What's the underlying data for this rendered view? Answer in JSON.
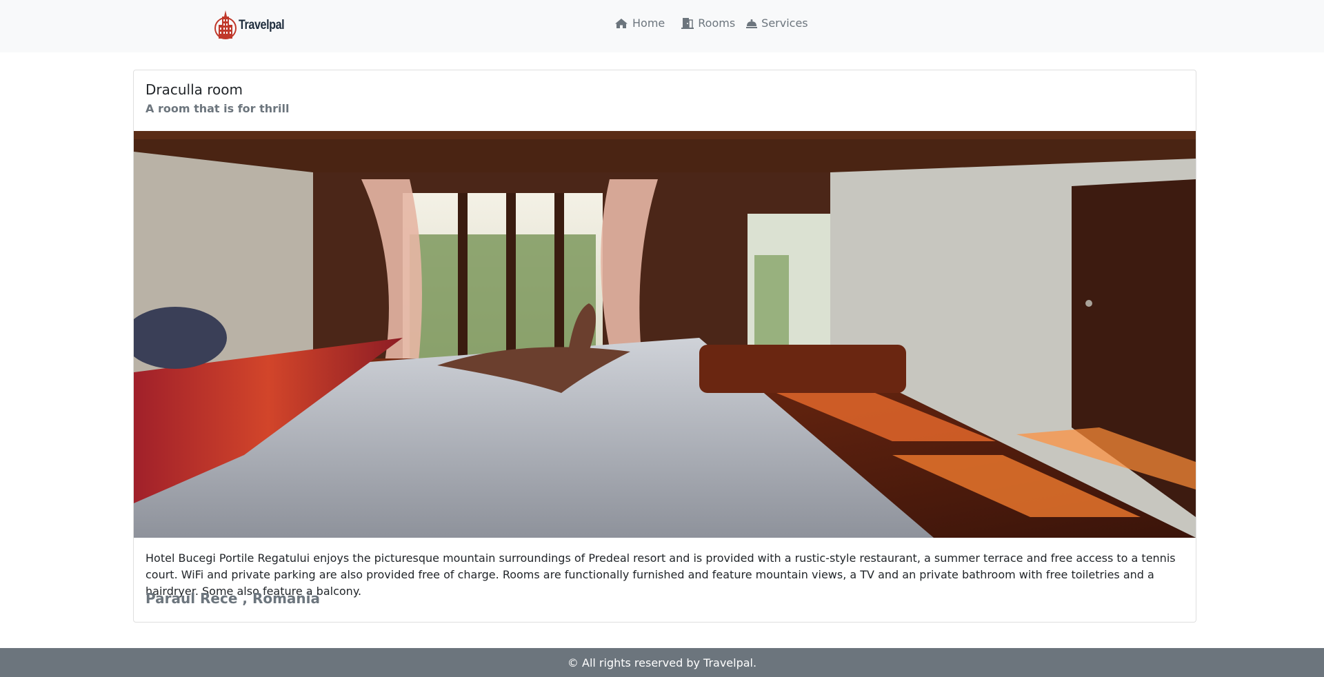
{
  "brand": {
    "name": "Travelpal",
    "logo_icon": "hotel-tower-icon",
    "accent": "#c0392b"
  },
  "nav": [
    {
      "label": "Home",
      "icon": "home-icon"
    },
    {
      "label": "Rooms",
      "icon": "door-icon"
    },
    {
      "label": "Services",
      "icon": "bell-icon"
    }
  ],
  "room": {
    "title": "Draculla room",
    "subtitle": "A room that is for thrill",
    "description": "Hotel Bucegi Portile Regatului enjoys the picturesque mountain surroundings of Predeal resort and is provided with a rustic-style restaurant, a summer terrace and free access to a tennis court. WiFi and private parking are also provided free of charge. Rooms are functionally furnished and feature mountain views, a TV and an private bathroom with free toiletries and a hairdryer. Some also feature a balcony.",
    "location": "Paraul Rece , Romania"
  },
  "footer": {
    "text": "© All rights reserved by Travelpal."
  },
  "colors": {
    "navbar_bg": "#f8f9fa",
    "muted_text": "#6c757d",
    "footer_bg": "#6c757d"
  }
}
